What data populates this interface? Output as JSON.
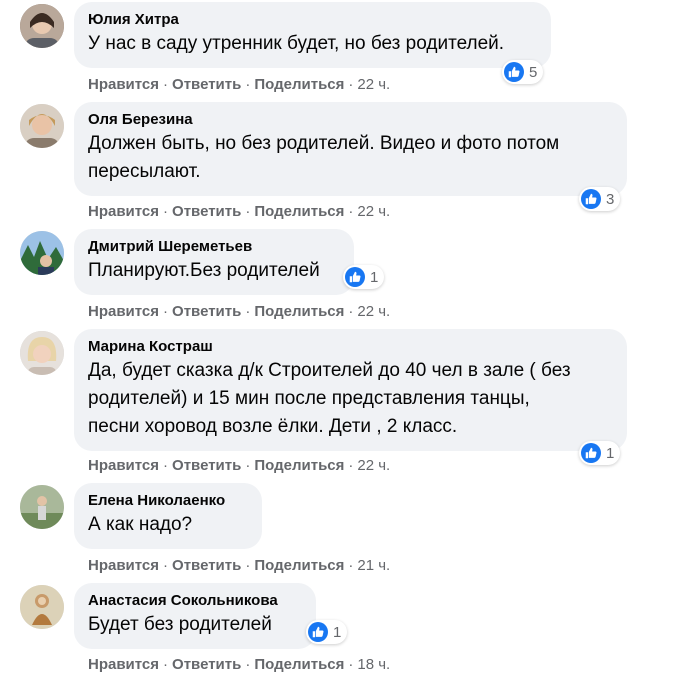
{
  "colors": {
    "accent": "#1877f2",
    "bubble": "#f0f2f5",
    "meta": "#65676b",
    "text": "#050505"
  },
  "actions": {
    "like": "Нравится",
    "reply": "Ответить",
    "share": "Поделиться",
    "sep": "·"
  },
  "comments": [
    {
      "author": "Юлия Хитра",
      "text": [
        "У нас в саду утренник будет, но без родителей."
      ],
      "time": "22 ч.",
      "likes": "5",
      "avatar_icon": "user-avatar-icon"
    },
    {
      "author": "Оля Березина",
      "text": [
        "Должен быть, но без родителей. Видео и фото потом",
        "пересылают."
      ],
      "time": "22 ч.",
      "likes": "3",
      "avatar_icon": "user-avatar-icon"
    },
    {
      "author": "Дмитрий Шереметьев",
      "text": [
        "Планируют.Без родителей"
      ],
      "time": "22 ч.",
      "likes": "1",
      "avatar_icon": "user-avatar-icon"
    },
    {
      "author": "Марина Костраш",
      "text": [
        "Да, будет сказка д/к Строителей до 40 чел в зале ( без",
        "родителей) и 15 мин после представления танцы,",
        "песни хоровод возле ёлки. Дети , 2 класс."
      ],
      "time": "22 ч.",
      "likes": "1",
      "avatar_icon": "user-avatar-icon"
    },
    {
      "author": "Елена Николаенко",
      "text": [
        "А как надо?"
      ],
      "time": "21 ч.",
      "likes": "",
      "avatar_icon": "user-avatar-icon"
    },
    {
      "author": "Анастасия Сокольникова",
      "text": [
        "Будет без родителей"
      ],
      "time": "18 ч.",
      "likes": "1",
      "avatar_icon": "user-avatar-icon"
    }
  ]
}
